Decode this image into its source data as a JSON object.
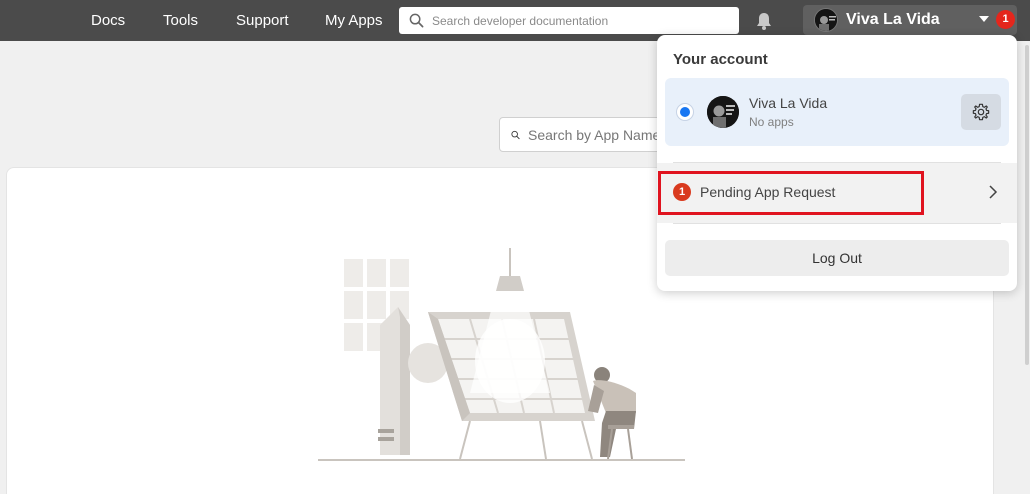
{
  "nav": {
    "links": [
      "Docs",
      "Tools",
      "Support",
      "My Apps"
    ],
    "search_placeholder": "Search developer documentation",
    "account_name": "Viva La Vida",
    "notification_count": "1"
  },
  "main": {
    "search_placeholder": "Search by App Name"
  },
  "account_menu": {
    "title": "Your account",
    "account": {
      "name": "Viva La Vida",
      "subtitle": "No apps",
      "selected": true
    },
    "pending": {
      "count": "1",
      "label": "Pending App Request"
    },
    "logout_label": "Log Out"
  },
  "colors": {
    "topbar": "#4b4b4b",
    "accent": "#1877f2",
    "badge": "#e4261c",
    "highlight": "#e0131f"
  }
}
